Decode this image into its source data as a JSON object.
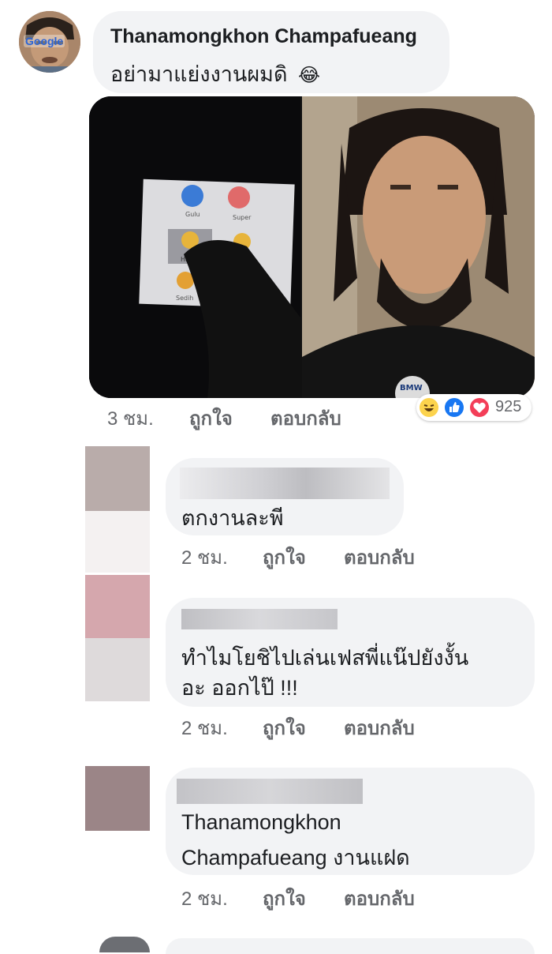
{
  "colors": {
    "bubble": "#f2f3f5",
    "meta_text": "#65676b",
    "like_blue": "#1877f2",
    "love_red": "#f33e58",
    "haha_yellow": "#fcd34d"
  },
  "main_comment": {
    "author": "Thanamongkhon Champafueang",
    "text": "อย่ามาแย่งงานผมดิ",
    "emoji": "😂",
    "avatar_badge": "Google",
    "photo": {
      "screen_labels": [
        "Gulu",
        "Super",
        "Ha",
        "Sedih"
      ],
      "shirt_logo": "BMW"
    },
    "time": "3 ชม.",
    "like_label": "ถูกใจ",
    "reply_label": "ตอบกลับ",
    "reaction_count": "925",
    "reaction_icons": [
      "haha-icon",
      "like-icon",
      "love-icon"
    ]
  },
  "replies": [
    {
      "text": "ตกงานละพี",
      "time": "2 ชม.",
      "like_label": "ถูกใจ",
      "reply_label": "ตอบกลับ"
    },
    {
      "text_line1": "ทำไมโยชิไปเล่นเฟสพี่แน๊ปยังงั้น",
      "text_line2": "อะ ออกไป๊ !!!",
      "time": "2 ชม.",
      "like_label": "ถูกใจ",
      "reply_label": "ตอบกลับ"
    },
    {
      "text_line1": "Thanamongkhon",
      "text_line2": "Champafueang  งานแฝด",
      "time": "2 ชม.",
      "like_label": "ถูกใจ",
      "reply_label": "ตอบกลับ"
    }
  ]
}
